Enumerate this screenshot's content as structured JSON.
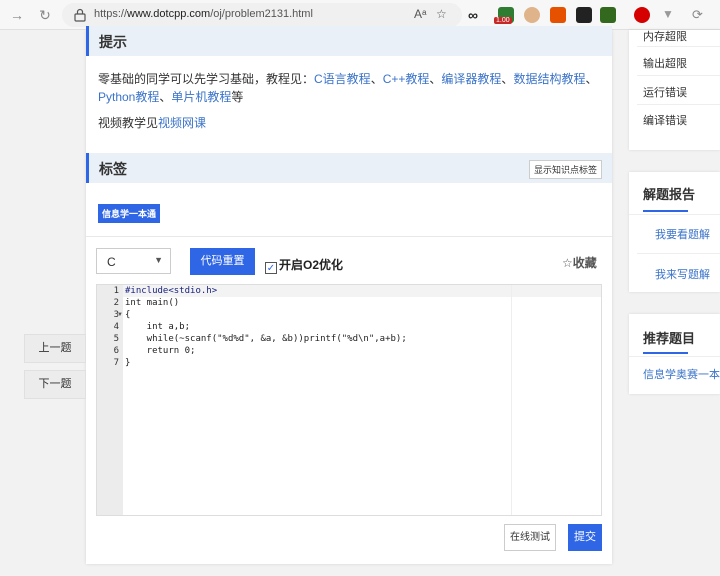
{
  "browser": {
    "url_prefix": "https://",
    "url_domain": "www.dotcpp.com",
    "url_path": "/oj/problem2131.html",
    "ext_badge": "1.00"
  },
  "hint": {
    "title": "提示",
    "intro": "零基础的同学可以先学习基础，教程见：",
    "links": [
      "C语言教程",
      "C++教程",
      "编译器教程",
      "数据结构教程",
      "Python教程",
      "单片机教程"
    ],
    "suffix": "等",
    "video_prefix": "视频教学见",
    "video_link": "视频网课"
  },
  "tags": {
    "title": "标签",
    "show_button": "显示知识点标签",
    "items": [
      "信息学一本通"
    ]
  },
  "editor": {
    "language": "C",
    "reset_label": "代码重置",
    "o2_label": "开启O2优化",
    "o2_checked": "✓",
    "fav_label": "☆收藏",
    "line_numbers": [
      "1",
      "2",
      "3",
      "4",
      "5",
      "6",
      "7"
    ],
    "lines": [
      "#include<stdio.h>",
      "int main()",
      "{",
      "    int a,b;",
      "    while(~scanf(\"%d%d\", &a, &b))printf(\"%d\\n\",a+b);",
      "    return 0;",
      "}"
    ]
  },
  "actions": {
    "test_label": "在线测试",
    "submit_label": "提交"
  },
  "nav": {
    "prev_label": "上一题",
    "next_label": "下一题"
  },
  "sidebar": {
    "status_items": [
      "内存超限",
      "输出超限",
      "运行错误",
      "编译错误"
    ],
    "report_title": "解题报告",
    "report_links": [
      "我要看题解",
      "我来写题解"
    ],
    "recommend_title": "推荐题目",
    "recommend_links": [
      "信息学奥赛一本通"
    ]
  },
  "colors": {
    "accent": "#2f66e6",
    "link": "#3a73c9"
  }
}
